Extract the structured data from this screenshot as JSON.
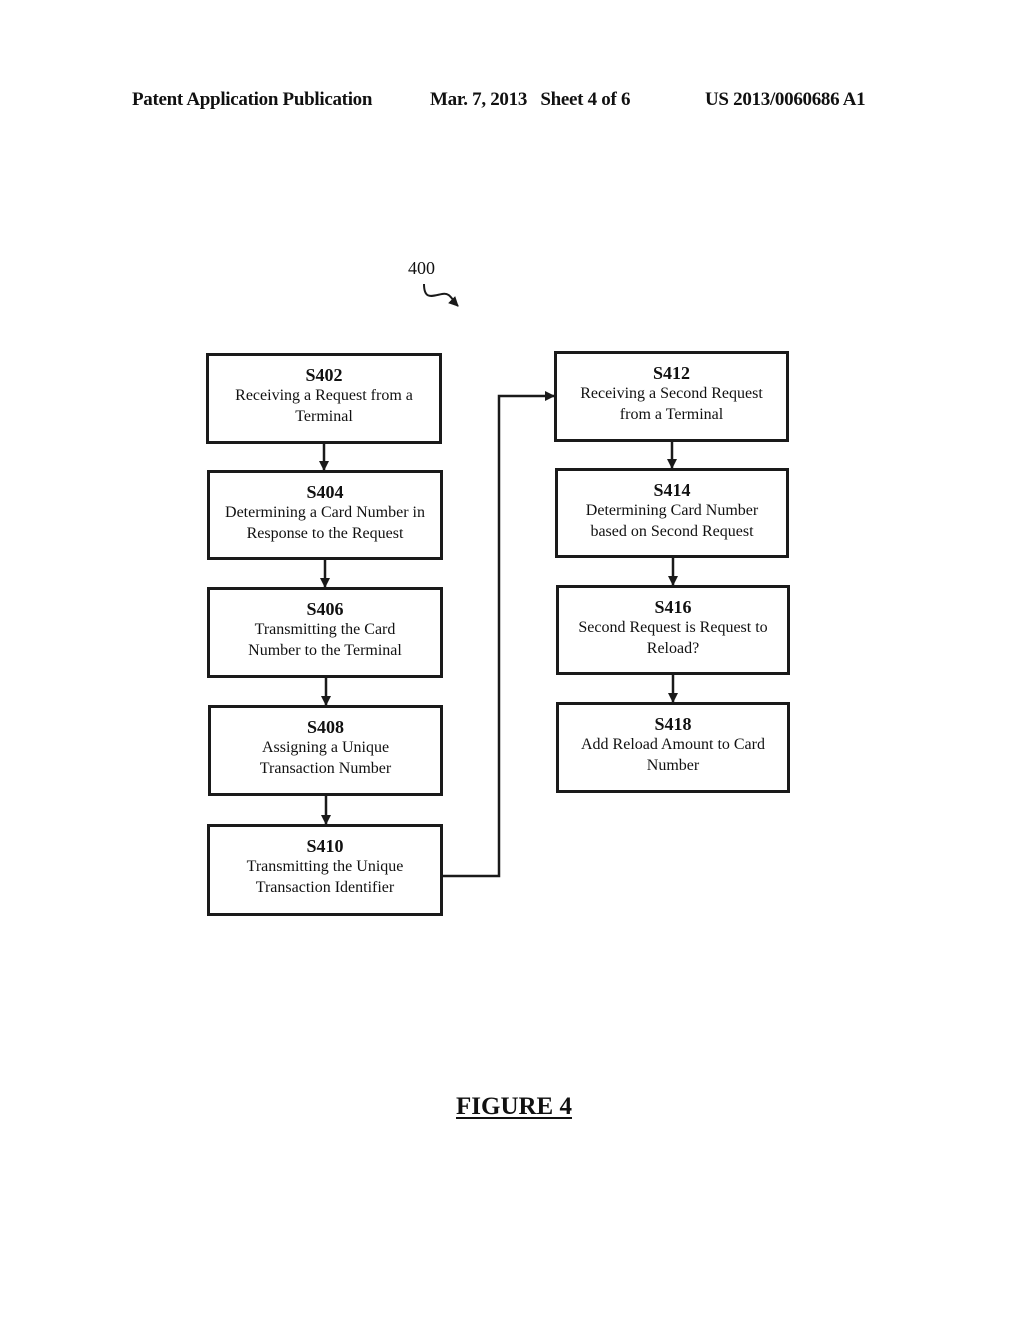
{
  "header": {
    "left": "Patent Application Publication",
    "middle": "Mar. 7, 2013   Sheet 4 of 6",
    "right": "US 2013/0060686 A1"
  },
  "diagram": {
    "reference_number": "400",
    "steps": [
      {
        "id": "S402",
        "text": "Receiving a Request from a Terminal"
      },
      {
        "id": "S404",
        "text": "Determining a Card Number in Response to the Request"
      },
      {
        "id": "S406",
        "text": "Transmitting the Card Number to the Terminal"
      },
      {
        "id": "S408",
        "text": "Assigning a Unique Transaction Number"
      },
      {
        "id": "S410",
        "text": "Transmitting the Unique Transaction Identifier"
      },
      {
        "id": "S412",
        "text": "Receiving a Second Request from a Terminal"
      },
      {
        "id": "S414",
        "text": "Determining Card Number based on Second Request"
      },
      {
        "id": "S416",
        "text": "Second Request is Request to Reload?"
      },
      {
        "id": "S418",
        "text": "Add Reload Amount to Card Number"
      }
    ],
    "edges": [
      [
        "S402",
        "S404"
      ],
      [
        "S404",
        "S406"
      ],
      [
        "S406",
        "S408"
      ],
      [
        "S408",
        "S410"
      ],
      [
        "S410",
        "S412"
      ],
      [
        "S412",
        "S414"
      ],
      [
        "S414",
        "S416"
      ],
      [
        "S416",
        "S418"
      ]
    ]
  },
  "figure_label": "FIGURE 4"
}
